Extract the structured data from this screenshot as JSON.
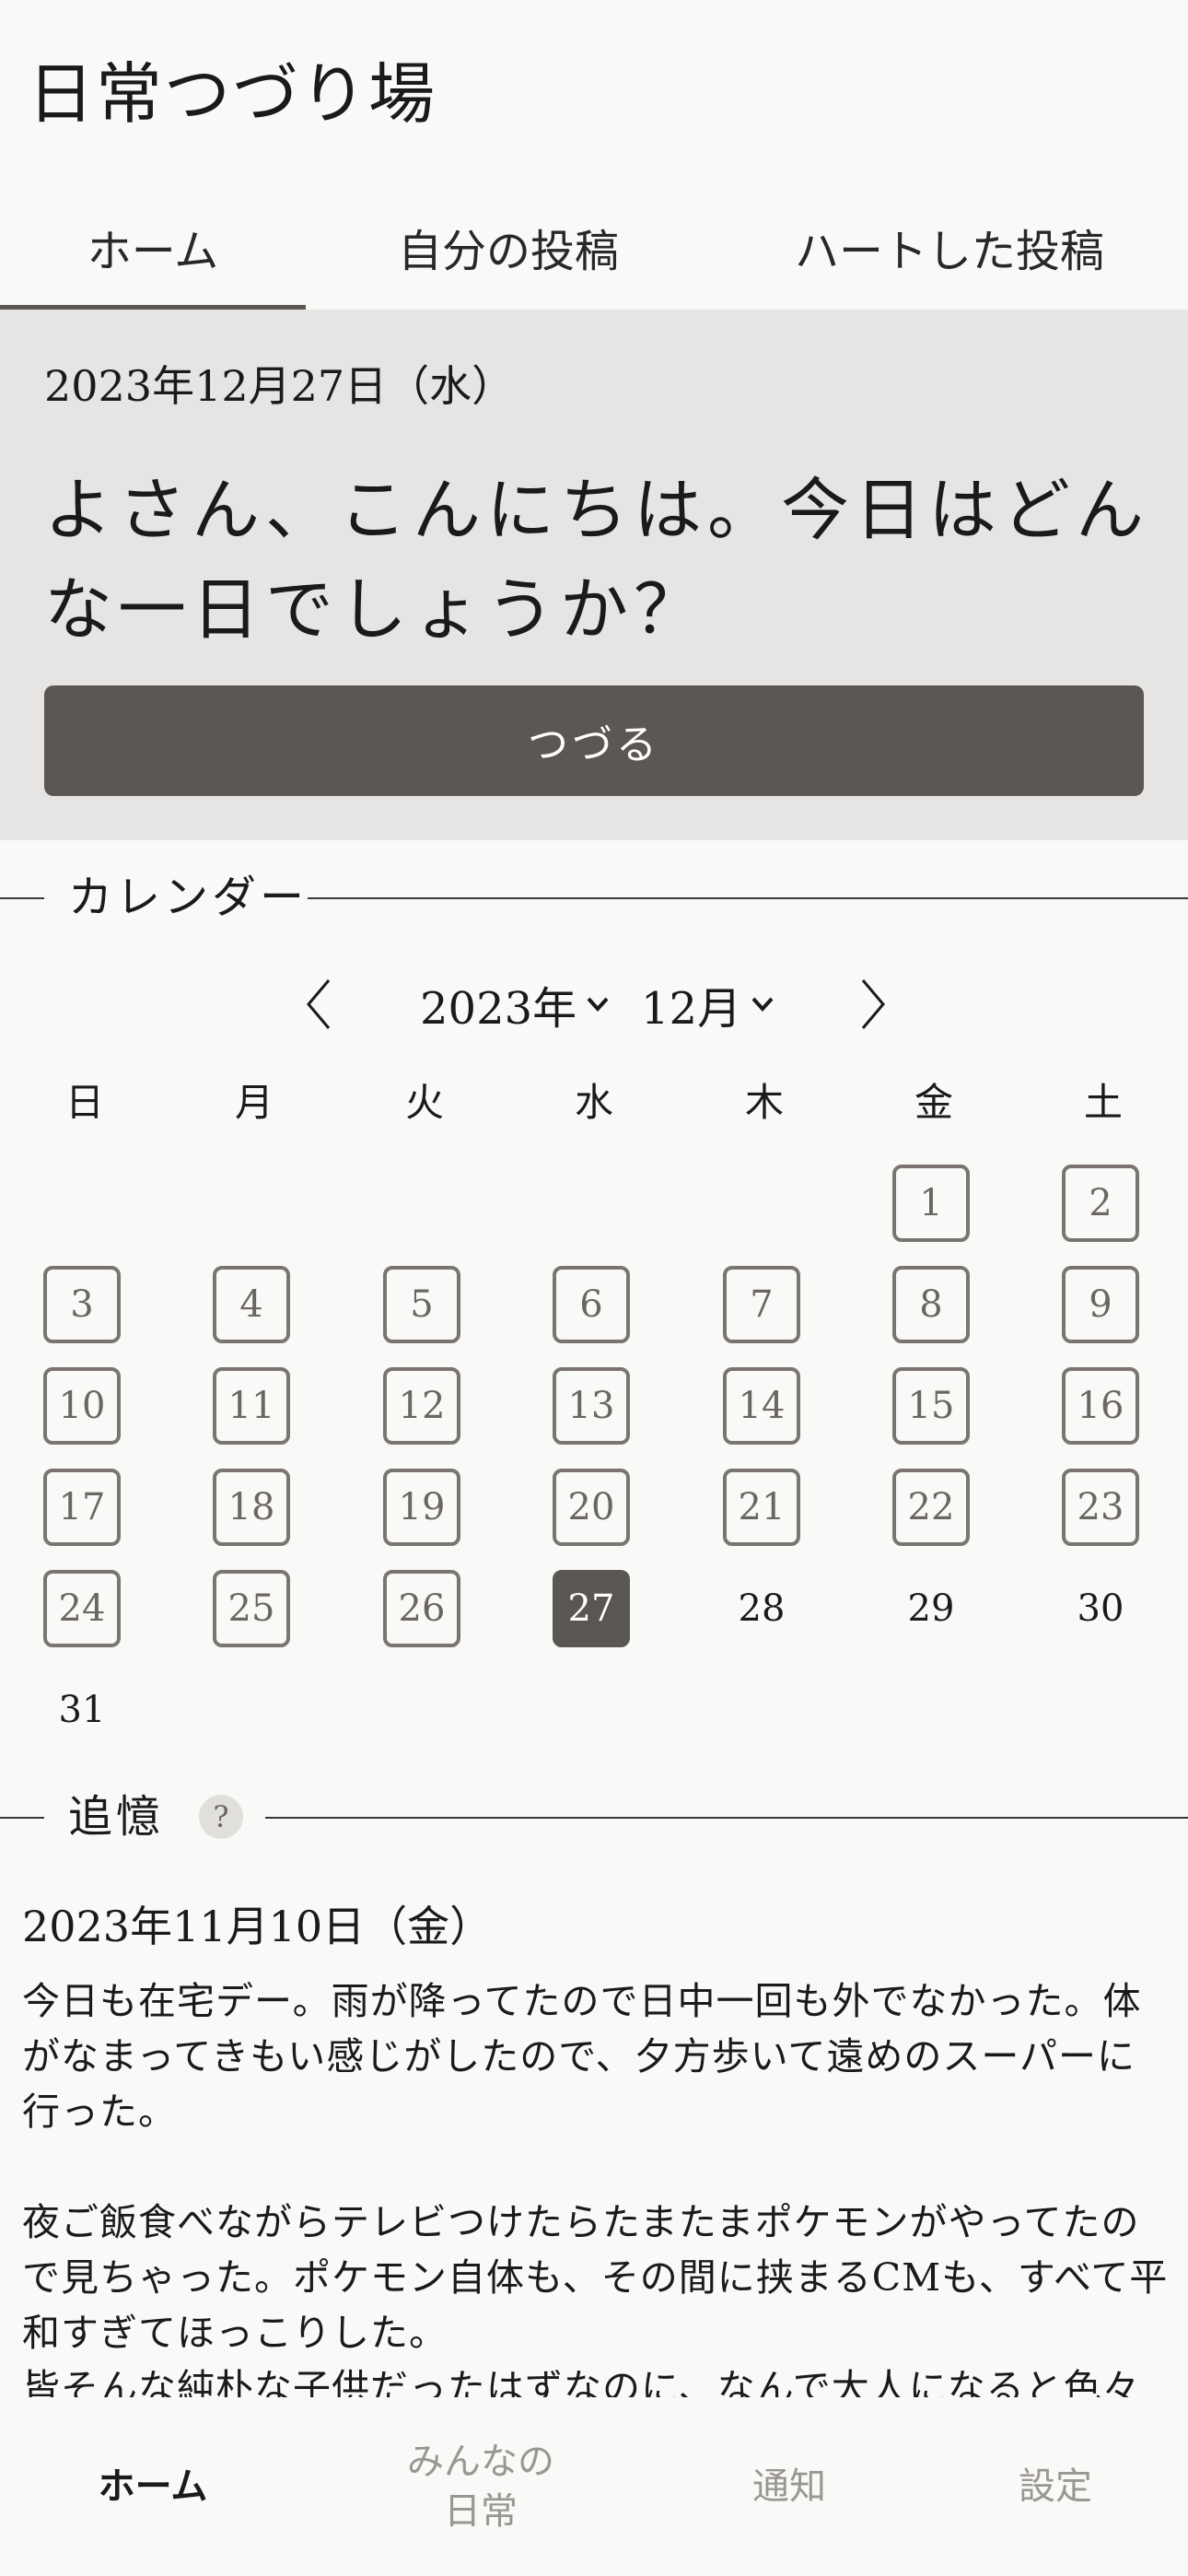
{
  "app": {
    "title": "日常つづり場"
  },
  "tabs": [
    {
      "label": "ホーム",
      "active": true
    },
    {
      "label": "自分の投稿",
      "active": false
    },
    {
      "label": "ハートした投稿",
      "active": false
    }
  ],
  "hero": {
    "date": "2023年12月27日（水）",
    "greeting": "よさん、こんにちは。今日はどんな一日でしょうか？",
    "write_button": "つづる"
  },
  "calendar": {
    "heading": "カレンダー",
    "prev_icon": "chevron-left-icon",
    "next_icon": "chevron-right-icon",
    "year_select": "2023年",
    "month_select": "12月",
    "weekdays": [
      "日",
      "月",
      "火",
      "水",
      "木",
      "金",
      "土"
    ],
    "first_weekday_index": 5,
    "today": 27,
    "days_with_posts": [
      1,
      2,
      3,
      4,
      5,
      6,
      7,
      8,
      9,
      10,
      11,
      12,
      13,
      14,
      15,
      16,
      17,
      18,
      19,
      20,
      21,
      22,
      23,
      24,
      25,
      26
    ],
    "days": [
      "1",
      "2",
      "3",
      "4",
      "5",
      "6",
      "7",
      "8",
      "9",
      "10",
      "11",
      "12",
      "13",
      "14",
      "15",
      "16",
      "17",
      "18",
      "19",
      "20",
      "21",
      "22",
      "23",
      "24",
      "25",
      "26",
      "27",
      "28",
      "29",
      "30",
      "31"
    ],
    "colors": {
      "today_bg": "#5a5651",
      "post_border": "#7a7571"
    }
  },
  "memory": {
    "heading": "追憶",
    "help_label": "?",
    "date": "2023年11月10日（金）",
    "body": "今日も在宅デー。雨が降ってたので日中一回も外でなかった。体がなまってきもい感じがしたので、夕方歩いて遠めのスーパーに行った。\n\n夜ご飯食べながらテレビつけたらたまたまポケモンがやってたので見ちゃった。ポケモン自体も、その間に挟まるCMも、すべて平和すぎてほっこりした。\n皆そんな純朴な子供だったはずなのに、なんで大人になると色々"
  },
  "bottom_nav": [
    {
      "label": "ホーム",
      "active": true
    },
    {
      "label": "みんなの\n日常",
      "active": false
    },
    {
      "label": "通知",
      "active": false
    },
    {
      "label": "設定",
      "active": false
    }
  ]
}
